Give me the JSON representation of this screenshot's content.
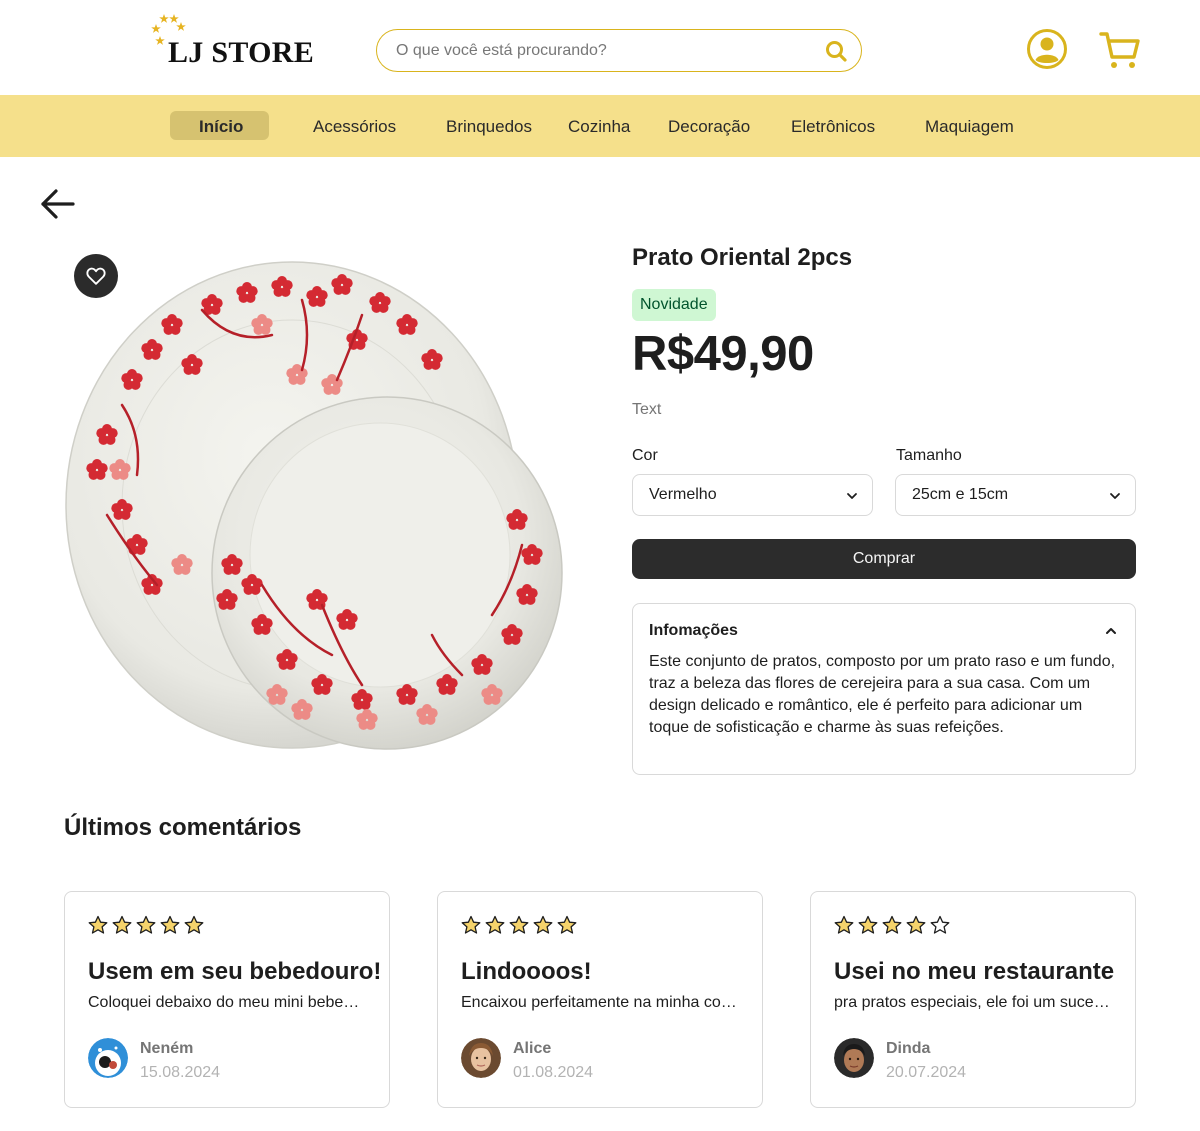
{
  "header": {
    "logo_text": "LJ STORE",
    "search_placeholder": "O que você está procurando?",
    "accent_color": "#d9b41d"
  },
  "nav": {
    "background": "#f5e08b",
    "items": [
      {
        "label": "Início",
        "active": true
      },
      {
        "label": "Acessórios"
      },
      {
        "label": "Brinquedos"
      },
      {
        "label": "Cozinha"
      },
      {
        "label": "Decoração"
      },
      {
        "label": "Eletrônicos"
      },
      {
        "label": "Maquiagem"
      }
    ]
  },
  "product": {
    "title": "Prato Oriental 2pcs",
    "badge": "Novidade",
    "price": "R$49,90",
    "text_label": "Text",
    "color_label": "Cor",
    "color_value": "Vermelho",
    "size_label": "Tamanho",
    "size_value": "25cm e 15cm",
    "buy_label": "Comprar",
    "info_title": "Infomações",
    "info_body": "Este conjunto de pratos, composto por um prato raso e um fundo, traz a beleza das flores de cerejeira para a sua casa. Com um design delicado e romântico, ele é perfeito para adicionar um toque de sofisticação e charme às suas refeições."
  },
  "comments": {
    "title": "Últimos comentários",
    "items": [
      {
        "rating": 5,
        "title": "Usem em seu bebedouro!",
        "body": "Coloquei debaixo do meu mini bebedouro e ficou ótimo",
        "author": "Neném",
        "date": "15.08.2024"
      },
      {
        "rating": 5,
        "title": "Lindoooos!",
        "body": "Encaixou perfeitamente na minha cozinha",
        "author": "Alice",
        "date": "01.08.2024"
      },
      {
        "rating": 4,
        "title": "Usei no meu restaurante",
        "body": "pra pratos especiais, ele foi um sucesso",
        "author": "Dinda",
        "date": "20.07.2024"
      }
    ]
  },
  "icons": [
    "star-logo-icon",
    "search-icon",
    "user-icon",
    "cart-icon",
    "arrow-left-icon",
    "heart-icon",
    "chevron-down-icon",
    "chevron-up-icon",
    "star-icon"
  ]
}
